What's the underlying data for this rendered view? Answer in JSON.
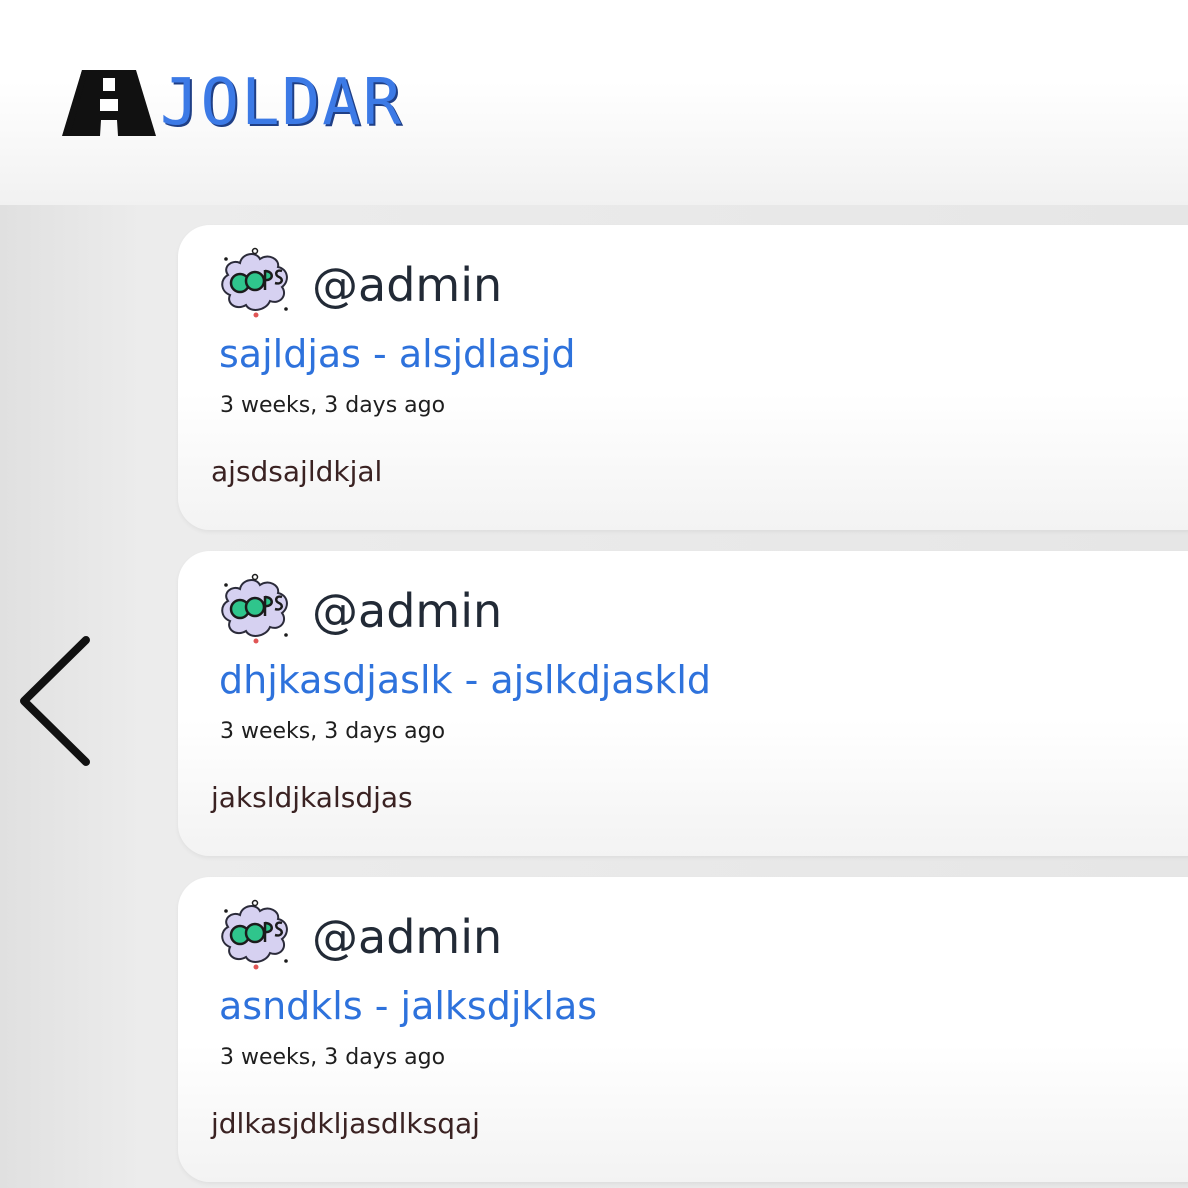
{
  "header": {
    "brand_name": "JOLDAR",
    "logo_icon": "road-icon"
  },
  "navigation": {
    "back_icon": "chevron-left-icon"
  },
  "posts": [
    {
      "avatar_icon": "oops-sticker-icon",
      "username": "@admin",
      "title": "sajldjas - alsjdlasjd",
      "timestamp": "3 weeks, 3 days ago",
      "body": "ajsdsajldkjal"
    },
    {
      "avatar_icon": "oops-sticker-icon",
      "username": "@admin",
      "title": "dhjkasdjaslk - ajslkdjaskld",
      "timestamp": "3 weeks, 3 days ago",
      "body": "jaksldjkalsdjas"
    },
    {
      "avatar_icon": "oops-sticker-icon",
      "username": "@admin",
      "title": "asndkls - jalksdjklas",
      "timestamp": "3 weeks, 3 days ago",
      "body": "jdlkasjdkljasdlksqaj"
    }
  ],
  "colors": {
    "brand_blue": "#3c7ae6",
    "title_blue": "#2e72dc",
    "username_dark": "#222a36",
    "body_text": "#3a2222",
    "sticker_green": "#2fc58c",
    "sticker_purple": "#c9c3ec"
  }
}
